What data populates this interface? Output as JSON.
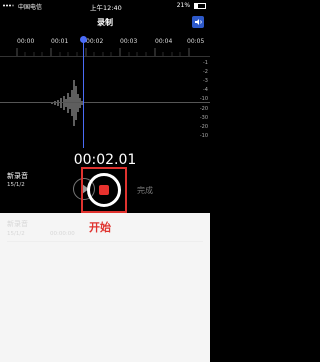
{
  "status": {
    "carrier": "中国电信",
    "time": "上午12:40",
    "battery": "21%"
  },
  "header": {
    "title": "录制"
  },
  "timeline": {
    "labels": [
      "00:00",
      "00:01",
      "00:02",
      "00:03",
      "00:04",
      "00:05"
    ]
  },
  "db_labels": [
    "-1",
    "-2",
    "-3",
    "-4",
    "-10",
    "-20",
    "-30",
    "-20",
    "-10"
  ],
  "recording": {
    "elapsed": "00:02.01",
    "name": "新录音",
    "date": "15/1/2"
  },
  "controls": {
    "done": "完成"
  },
  "list": {
    "name": "新录音",
    "date": "15/1/2",
    "duration": "00:00:00"
  },
  "annotation": {
    "start": "开始"
  }
}
